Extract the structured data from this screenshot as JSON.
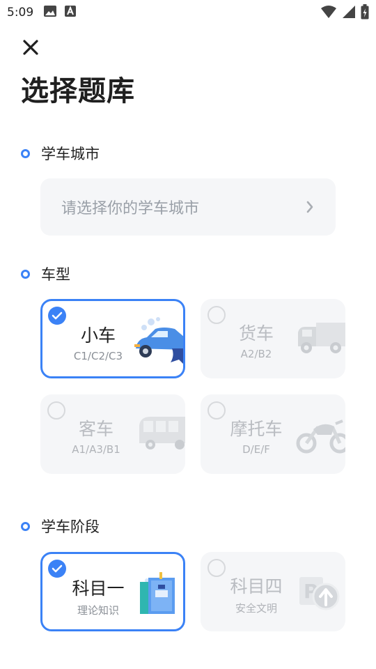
{
  "status_bar": {
    "time": "5:09",
    "icons": [
      "image-icon",
      "font-icon",
      "wifi-icon",
      "signal-icon",
      "battery-icon"
    ]
  },
  "header": {
    "close_icon": "close-icon",
    "title": "选择题库"
  },
  "city": {
    "section_label": "学车城市",
    "placeholder": "请选择你的学车城市"
  },
  "vehicle": {
    "section_label": "车型",
    "options": [
      {
        "title": "小车",
        "sub": "C1/C2/C3",
        "selected": true,
        "icon": "car-icon"
      },
      {
        "title": "货车",
        "sub": "A2/B2",
        "selected": false,
        "icon": "truck-icon"
      },
      {
        "title": "客车",
        "sub": "A1/A3/B1",
        "selected": false,
        "icon": "bus-icon"
      },
      {
        "title": "摩托车",
        "sub": "D/E/F",
        "selected": false,
        "icon": "motorcycle-icon"
      }
    ]
  },
  "stage": {
    "section_label": "学车阶段",
    "options": [
      {
        "title": "科目一",
        "sub": "理论知识",
        "selected": true,
        "icon": "book-icon"
      },
      {
        "title": "科目四",
        "sub": "安全文明",
        "selected": false,
        "icon": "parking-sign-icon"
      }
    ]
  },
  "colors": {
    "accent": "#3b82f6",
    "card_bg": "#f5f6f8",
    "muted_text": "#b9bcc1"
  }
}
